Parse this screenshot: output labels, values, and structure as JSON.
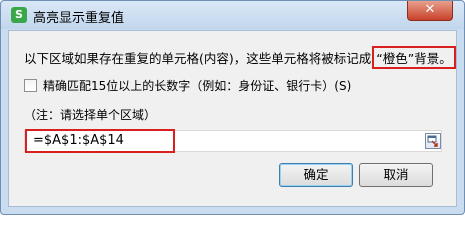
{
  "window": {
    "app_icon_glyph": "S",
    "title": "高亮显示重复值",
    "close_glyph": "✕"
  },
  "description": {
    "prefix": "以下区域如果存在重复的单元格(内容)，这些单元格将被标记成",
    "highlight": "“橙色”背景。"
  },
  "options": {
    "long_number_label": "精确匹配15位以上的长数字（例如：身份证、银行卡）(S)",
    "long_number_checked": false
  },
  "note": "（注：请选择单个区域）",
  "range_input": {
    "value": "=$A$1:$A$14"
  },
  "buttons": {
    "ok": "确定",
    "cancel": "取消"
  },
  "colors": {
    "highlight_border": "#d9201f",
    "app_icon": "#3aa84a"
  }
}
